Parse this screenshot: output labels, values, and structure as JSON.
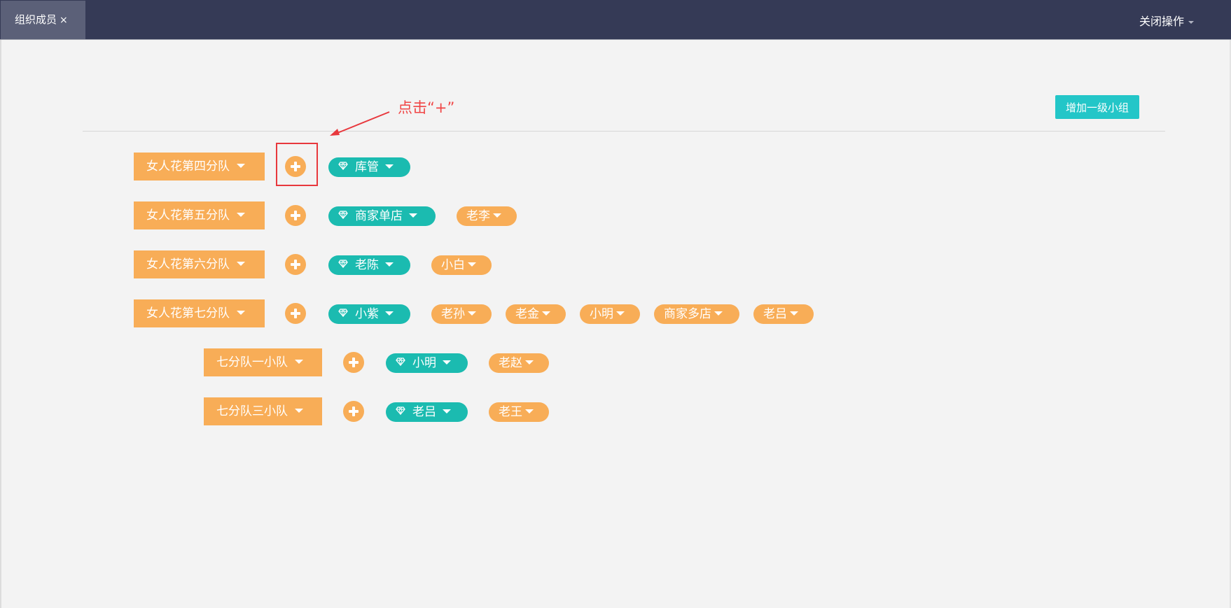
{
  "tab": {
    "label": "组织成员",
    "close": "×"
  },
  "header": {
    "close_ops": "关闭操作"
  },
  "toolbar": {
    "add_group": "增加一级小组"
  },
  "annotation": {
    "text": "点击“+”"
  },
  "rows": [
    {
      "group": "女人花第四分队",
      "leader": "库管",
      "members": []
    },
    {
      "group": "女人花第五分队",
      "leader": "商家单店",
      "members": [
        "老李"
      ]
    },
    {
      "group": "女人花第六分队",
      "leader": "老陈",
      "members": [
        "小白"
      ]
    },
    {
      "group": "女人花第七分队",
      "leader": "小紫",
      "members": [
        "老孙",
        "老金",
        "小明",
        "商家多店",
        "老吕"
      ]
    },
    {
      "group": "七分队一小队",
      "leader": "小明",
      "members": [
        "老赵"
      ]
    },
    {
      "group": "七分队三小队",
      "leader": "老吕",
      "members": [
        "老王"
      ]
    }
  ],
  "colors": {
    "orange": "#f8ad57",
    "teal": "#1bbbb0",
    "topbar": "#353a56",
    "add_btn": "#23c6c8",
    "annotation": "#e8383d"
  },
  "icons": {
    "leader": "diamond-icon",
    "add": "plus-circle-icon"
  }
}
